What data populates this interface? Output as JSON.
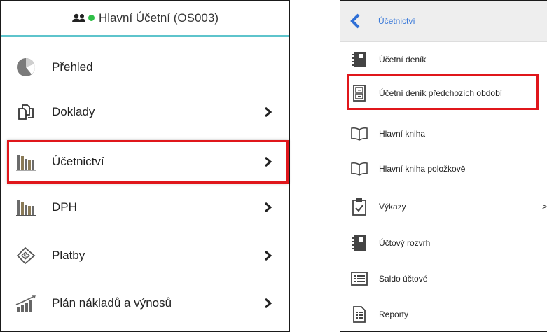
{
  "left": {
    "header": {
      "title": "Hlavní Účetní (OS003)"
    },
    "items": [
      {
        "label": "Přehled",
        "icon": "pie-chart-icon",
        "has_chevron": false
      },
      {
        "label": "Doklady",
        "icon": "documents-icon",
        "has_chevron": true
      },
      {
        "label": "Účetnictví",
        "icon": "books-icon",
        "has_chevron": true
      },
      {
        "label": "DPH",
        "icon": "books-icon",
        "has_chevron": true
      },
      {
        "label": "Platby",
        "icon": "payment-icon",
        "has_chevron": true
      },
      {
        "label": "Plán nákladů a výnosů",
        "icon": "growth-chart-icon",
        "has_chevron": true
      }
    ]
  },
  "right": {
    "header": {
      "title": "Účetnictví"
    },
    "items": [
      {
        "label": "Účetní deník",
        "icon": "journal-icon"
      },
      {
        "label": "Účetní deník předchozích období",
        "icon": "archive-cabinet-icon"
      },
      {
        "label": "Hlavní kniha",
        "icon": "open-book-icon"
      },
      {
        "label": "Hlavní kniha položkově",
        "icon": "open-book-icon"
      },
      {
        "label": "Výkazy",
        "icon": "clipboard-check-icon",
        "chevron": ">"
      },
      {
        "label": "Účtový rozvrh",
        "icon": "journal-icon"
      },
      {
        "label": "Saldo účtové",
        "icon": "list-card-icon"
      },
      {
        "label": "Reporty",
        "icon": "report-document-icon"
      }
    ]
  },
  "colors": {
    "header_accent": "#5ec4cc",
    "online_dot": "#2fbf47",
    "highlight_border": "#e0161b",
    "link_blue": "#3b7ad9"
  }
}
